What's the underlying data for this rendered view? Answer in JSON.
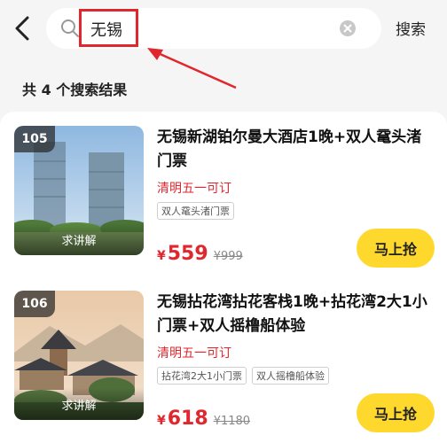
{
  "header": {
    "search_query": "无锡",
    "search_button": "搜索"
  },
  "results": {
    "count_text": "共 4 个搜索结果",
    "items": [
      {
        "rank": "105",
        "thumb_label": "求讲解",
        "title": "无锡新湖铂尔曼大酒店1晚+双人鼋头渚门票",
        "subtitle": "清明五一可订",
        "tags": [
          "双人鼋头渚门票"
        ],
        "price_symbol": "¥",
        "price": "559",
        "original_price": "¥999",
        "buy_label": "马上抢"
      },
      {
        "rank": "106",
        "thumb_label": "求讲解",
        "title": "无锡拈花湾拈花客栈1晚+拈花湾2大1小门票+双人摇橹船体验",
        "subtitle": "清明五一可订",
        "tags": [
          "拈花湾2大1小门票",
          "双人摇橹船体验"
        ],
        "price_symbol": "¥",
        "price": "618",
        "original_price": "¥1180",
        "buy_label": "马上抢"
      }
    ]
  },
  "colors": {
    "accent_red": "#e0272e",
    "buy_yellow": "#ffd82e"
  },
  "icons": [
    "back-arrow-icon",
    "search-icon",
    "clear-icon"
  ]
}
